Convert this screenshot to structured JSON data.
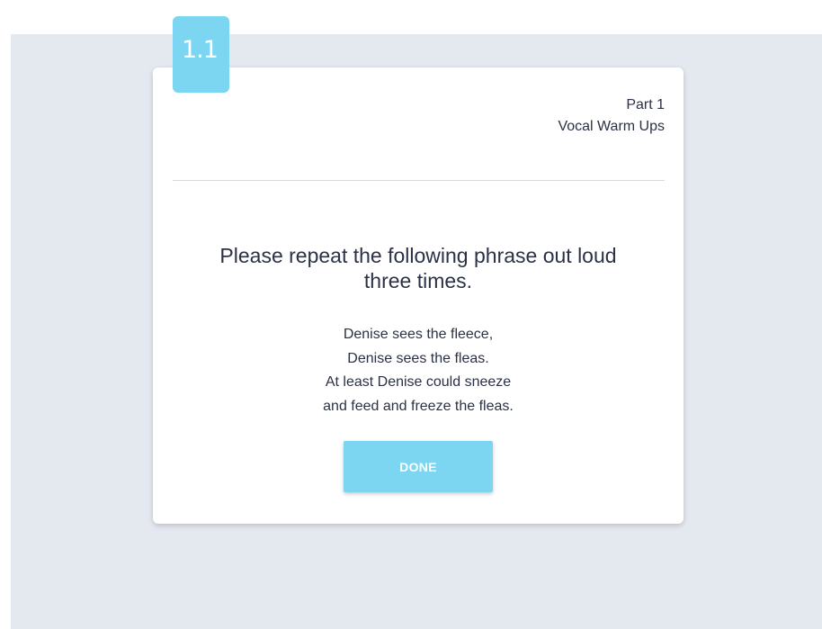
{
  "step": {
    "badge_label": "1.1"
  },
  "header": {
    "part_label": "Part 1",
    "section_title": "Vocal Warm Ups"
  },
  "task": {
    "instruction_line1": "Please repeat the following phrase out loud",
    "instruction_line2": "three times.",
    "phrase_lines": [
      "Denise sees the fleece,",
      "Denise sees the fleas.",
      "At least Denise could sneeze",
      "and feed and freeze the fleas."
    ]
  },
  "actions": {
    "done_label": "DONE"
  },
  "colors": {
    "accent": "#7dd6f1",
    "background": "#e4e8ef",
    "text": "#2b3245"
  }
}
